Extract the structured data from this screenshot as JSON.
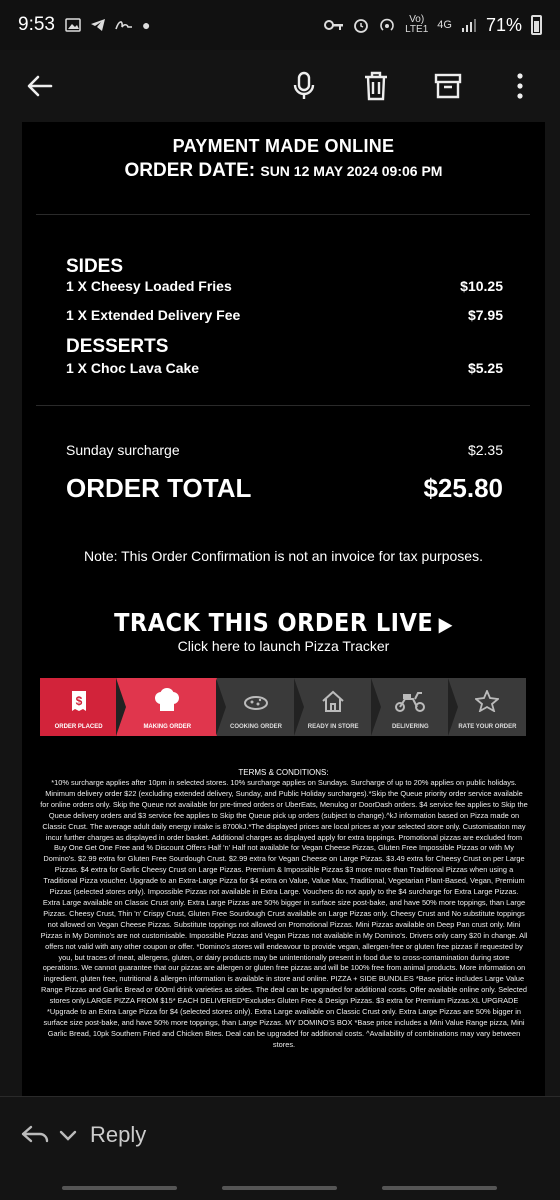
{
  "status_bar": {
    "time": "9:53",
    "battery": "71%",
    "network_top": "Vo)",
    "network_bottom": "LTE1",
    "network_gen": "4G"
  },
  "toolbar": {
    "back_icon": "arrow-left-icon",
    "mic_icon": "mic-icon",
    "delete_icon": "trash-icon",
    "archive_icon": "archive-icon",
    "more_icon": "more-vert-icon"
  },
  "email": {
    "payment_title": "PAYMENT MADE ONLINE",
    "order_date_label": "ORDER DATE:",
    "order_date_value": "SUN 12 MAY 2024 09:06 PM",
    "sections": [
      {
        "heading": "SIDES",
        "items": [
          {
            "name": "1 X Cheesy Loaded Fries",
            "price": "$10.25"
          },
          {
            "name": "1 X Extended Delivery Fee",
            "price": "$7.95"
          }
        ]
      },
      {
        "heading": "DESSERTS",
        "items": [
          {
            "name": "1 X Choc Lava Cake",
            "price": "$5.25"
          }
        ]
      }
    ],
    "surcharge_label": "Sunday surcharge",
    "surcharge_value": "$2.35",
    "total_label": "ORDER TOTAL",
    "total_value": "$25.80",
    "note": "Note: This Order Confirmation is not an invoice for tax purposes.",
    "track_title": "TRACK THIS ORDER LIVE",
    "track_sub": "Click here to launch Pizza Tracker",
    "tracker_steps": [
      {
        "label": "ORDER PLACED",
        "icon": "receipt-dollar-icon"
      },
      {
        "label": "MAKING ORDER",
        "icon": "chef-hat-icon"
      },
      {
        "label": "COOKING ORDER",
        "icon": "oven-icon"
      },
      {
        "label": "READY IN STORE",
        "icon": "house-icon"
      },
      {
        "label": "DELIVERING",
        "icon": "scooter-icon"
      },
      {
        "label": "RATE YOUR ORDER",
        "icon": "star-icon"
      }
    ],
    "terms_title": "TERMS & CONDITIONS:",
    "terms_text": "*10% surcharge applies after 10pm in selected stores. 10% surcharge applies on Sundays. Surcharge of up to 20% applies on public holidays. Minimum delivery order $22 (excluding extended delivery, Sunday, and Public Holiday surcharges).*Skip the Queue priority order service available for online orders only. Skip the Queue not available for pre-timed orders or UberEats, Menulog or DoorDash orders. $4 service fee applies to Skip the Queue delivery orders and $3 service fee applies to Skip the Queue pick up orders (subject to change).^kJ information based on Pizza made on Classic Crust. The average adult daily energy intake is 8700kJ.*The displayed prices are local prices at your selected store only. Customisation may incur further charges as displayed in order basket. Additional charges as displayed apply for extra toppings. Promotional pizzas are excluded from Buy One Get One Free and % Discount Offers Half 'n' Half not available for Vegan Cheese Pizzas, Gluten Free Impossible Pizzas or with My Domino's. $2.99 extra for Gluten Free Sourdough Crust. $2.99 extra for Vegan Cheese on Large Pizzas. $3.49 extra for Cheesy Crust on per Large Pizzas. $4 extra for Garlic Cheesy Crust on Large Pizzas. Premium & Impossible Pizzas $3 more more than Traditional Pizzas when using a Traditional Pizza voucher. Upgrade to an Extra-Large Pizza for $4 extra on Value, Value Max, Traditional, Vegetarian Plant-Based, Vegan, Premium Pizzas (selected stores only). Impossible Pizzas not available in Extra Large. Vouchers do not apply to the $4 surcharge for Extra Large Pizzas. Extra Large available on Classic Crust only. Extra Large Pizzas are 50% bigger in surface size post-bake, and have 50% more toppings, than Large Pizzas. Cheesy Crust, Thin 'n' Crispy Crust, Gluten Free Sourdough Crust available on Large Pizzas only. Cheesy Crust and No substitute toppings not allowed on Vegan Cheese Pizzas. Substitute toppings not allowed on Promotional Pizzas. Mini Pizzas available on Deep Pan crust only. Mini Pizzas in My Domino's are not customisable. Impossible Pizzas and Vegan Pizzas not available in My Domino's. Drivers only carry $20 in change. All offers not valid with any other coupon or offer. *Domino's stores will endeavour to provide vegan, allergen-free or gluten free pizzas if requested by you, but traces of meat, allergens, gluten, or dairy products may be unintentionally present in food due to cross-contamination during store operations. We cannot guarantee that our pizzas are allergen or gluten free pizzas and will be 100% free from animal products. More information on ingredient, gluten free, nutritional & allergen information is available in store and online. PIZZA + SIDE BUNDLES *Base price includes Large Value Range Pizzas and Garlic Bread or 600ml drink varieties as sides. The deal can be upgraded for additional costs. Offer available online only. Selected stores only.LARGE PIZZA FROM $15* EACH DELIVERED*Excludes Gluten Free & Design Pizzas. $3 extra for Premium Pizzas.XL UPGRADE *Upgrade to an Extra Large Pizza for $4 (selected stores only). Extra Large available on Classic Crust only. Extra Large Pizzas are 50% bigger in surface size post-bake, and have 50% more toppings, than Large Pizzas. MY DOMINO'S BOX *Base price includes a Mini Value Range pizza, Mini Garlic Bread, 10pk Southern Fried and Chicken Bites. Deal can be upgraded for additional costs. ^Availability of combinations may vary between stores."
  },
  "reply": {
    "label": "Reply",
    "reply_icon": "reply-icon",
    "chevron_icon": "chevron-down-icon"
  }
}
